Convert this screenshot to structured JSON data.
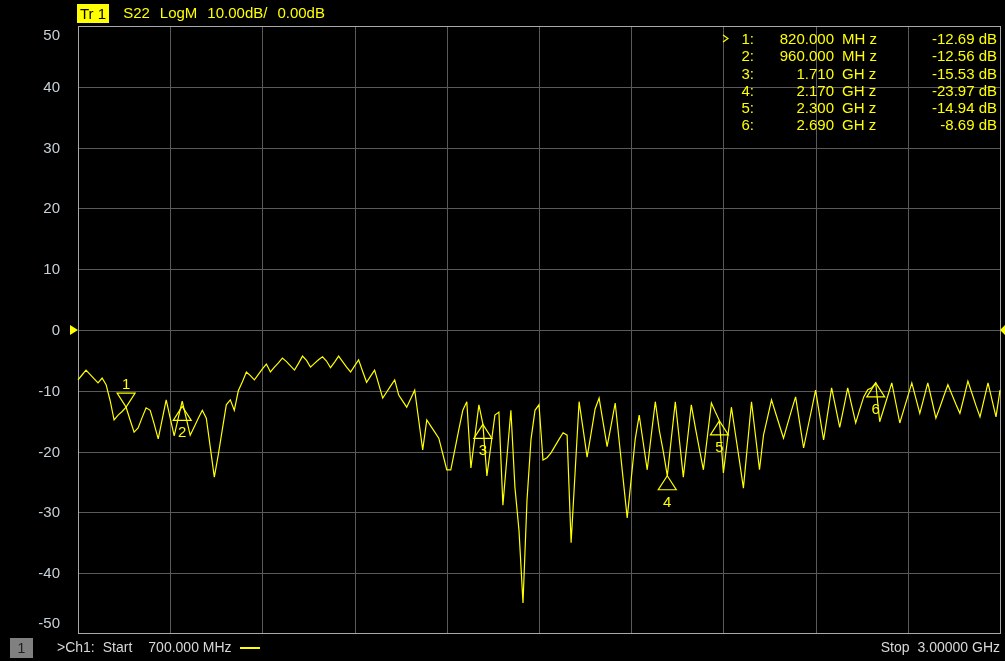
{
  "trace": {
    "name": "Tr 1",
    "active": true,
    "format": "LogM",
    "scale": "10.00dB/",
    "ref": "0.00dB"
  },
  "markers": [
    {
      "label": "1",
      "number": "1:",
      "freq": "820.000",
      "unit": "MH z",
      "value": "-12.69 dB",
      "selected": true
    },
    {
      "label": "2",
      "number": "2:",
      "freq": "960.000",
      "unit": "MH z",
      "value": "-12.56 dB",
      "selected": false
    },
    {
      "label": "3",
      "number": "3:",
      "freq": "1.710",
      "unit": "GH z",
      "value": "-15.53 dB",
      "selected": false
    },
    {
      "label": "4",
      "number": "4:",
      "freq": "2.170",
      "unit": "GH z",
      "value": "-23.97 dB",
      "selected": false
    },
    {
      "label": "5",
      "number": "5:",
      "freq": "2.300",
      "unit": "GH z",
      "value": "-14.94 dB",
      "selected": false
    },
    {
      "label": "6",
      "number": "6:",
      "freq": "2.690",
      "unit": "GH z",
      "value": "-8.69 dB",
      "selected": false
    }
  ],
  "chart_data": {
    "type": "line",
    "grid": true,
    "ylim": [
      -50,
      50
    ],
    "yticks": [
      50,
      40,
      30,
      20,
      10,
      0,
      -10,
      -20,
      -30,
      -40,
      -50
    ],
    "categories": [
      null,
      null,
      null,
      null,
      null,
      null,
      null,
      null,
      null,
      null,
      null,
      null,
      null,
      null,
      null,
      null,
      null,
      null,
      null,
      null,
      null,
      null,
      null,
      null,
      null,
      null,
      null,
      null,
      null,
      null,
      null,
      null,
      null,
      null,
      null,
      null,
      null,
      null,
      null,
      null,
      null,
      null,
      null,
      null,
      null,
      null,
      null,
      null,
      null,
      null,
      null,
      null,
      null,
      null,
      null,
      null,
      null,
      null,
      null,
      null,
      null,
      null,
      null,
      null,
      null,
      null,
      null,
      null,
      null,
      null,
      null,
      null,
      null,
      null,
      null,
      null,
      null,
      null,
      null,
      null,
      null,
      null,
      null,
      null,
      null,
      null,
      null,
      null,
      null,
      null,
      null,
      null,
      null,
      null,
      null,
      null,
      null,
      null,
      null,
      null,
      null,
      null,
      null,
      null,
      null,
      null,
      null,
      null,
      null,
      null,
      null,
      null,
      null,
      null,
      null,
      null,
      null,
      null,
      null,
      null,
      null,
      null,
      null,
      null,
      null,
      null,
      null,
      null,
      null,
      null,
      null,
      null,
      null,
      null,
      null,
      null,
      null,
      null,
      null,
      null,
      null,
      null,
      null,
      null,
      null,
      null,
      null,
      null,
      null,
      null,
      null,
      null,
      null,
      null,
      null,
      null,
      null,
      null,
      null,
      null,
      null,
      null,
      null,
      null,
      null,
      null,
      null,
      null,
      null,
      null,
      null,
      null,
      null,
      null,
      null,
      null,
      null,
      null,
      null,
      null,
      null,
      null,
      null,
      null,
      null,
      null,
      null,
      null,
      null,
      null,
      null,
      null,
      null,
      null,
      null,
      null,
      null,
      null,
      null,
      null,
      null,
      null,
      null,
      null,
      null,
      null,
      null,
      null,
      null,
      null,
      null,
      null,
      null,
      null,
      null,
      null,
      null,
      null,
      null,
      null,
      null,
      null,
      null,
      null,
      null,
      null,
      null,
      null,
      null,
      null,
      null
    ],
    "series": [
      {
        "name": "S22",
        "color": "#ffff00",
        "values": [
          -8.2,
          -7.4,
          -6.6,
          -7.3,
          -8.0,
          -8.7,
          -7.9,
          -9.0,
          -11.6,
          -14.8,
          -14.0,
          -13.4,
          -12.7,
          -14.8,
          -16.8,
          -16.1,
          -14.4,
          -12.8,
          -13.2,
          -15.5,
          -17.9,
          -14.7,
          -11.5,
          -14.5,
          -17.4,
          -14.5,
          -11.7,
          -14.5,
          -17.3,
          -15.9,
          -14.5,
          -13.2,
          -14.5,
          -19.3,
          -24.2,
          -20.5,
          -16.4,
          -12.3,
          -11.5,
          -13.2,
          -10.0,
          -8.5,
          -6.9,
          -7.5,
          -8.2,
          -7.3,
          -6.4,
          -5.6,
          -6.9,
          -6.1,
          -5.4,
          -4.6,
          -5.2,
          -5.9,
          -6.6,
          -5.5,
          -4.3,
          -5.0,
          -6.1,
          -5.5,
          -4.9,
          -4.4,
          -5.1,
          -6.2,
          -5.3,
          -4.3,
          -5.2,
          -6.1,
          -6.9,
          -5.9,
          -4.9,
          -6.8,
          -8.6,
          -7.6,
          -6.6,
          -8.9,
          -11.2,
          -10.2,
          -9.2,
          -8.2,
          -10.7,
          -11.7,
          -12.7,
          -11.3,
          -9.9,
          -14.8,
          -19.7,
          -14.8,
          -15.8,
          -16.8,
          -17.8,
          -20.4,
          -23.0,
          -23.0,
          -19.7,
          -16.4,
          -13.2,
          -11.8,
          -22.7,
          -17.5,
          -12.3,
          -15.5,
          -24.0,
          -19.0,
          -14.0,
          -13.5,
          -28.8,
          -21.0,
          -13.2,
          -25.8,
          -33.0,
          -44.9,
          -28.0,
          -18.0,
          -13.2,
          -12.3,
          -21.4,
          -21.0,
          -20.2,
          -19.1,
          -18.0,
          -16.9,
          -17.3,
          -35.0,
          -23.4,
          -11.8,
          -16.3,
          -20.9,
          -17.0,
          -13.0,
          -11.2,
          -15.2,
          -19.2,
          -15.6,
          -12.0,
          -18.3,
          -24.6,
          -30.9,
          -24.5,
          -18.0,
          -14.0,
          -18.5,
          -23.0,
          -17.4,
          -11.8,
          -16.5,
          -20.0,
          -24.0,
          -17.9,
          -11.8,
          -18.0,
          -24.2,
          -18.3,
          -12.3,
          -16.0,
          -19.5,
          -23.0,
          -17.5,
          -12.0,
          -13.5,
          -14.9,
          -23.5,
          -18.1,
          -12.7,
          -17.1,
          -21.5,
          -26.0,
          -18.9,
          -11.8,
          -17.4,
          -23.0,
          -17.3,
          -14.4,
          -11.5,
          -13.6,
          -15.7,
          -17.8,
          -15.5,
          -13.2,
          -11.0,
          -15.2,
          -19.4,
          -16.2,
          -13.1,
          -9.9,
          -14.0,
          -18.1,
          -13.8,
          -9.5,
          -12.7,
          -16.0,
          -12.8,
          -9.5,
          -12.4,
          -15.3,
          -13.1,
          -11.0,
          -9.8,
          -9.5,
          -8.7,
          -15.1,
          -13.0,
          -10.8,
          -8.7,
          -12.0,
          -15.3,
          -13.1,
          -10.9,
          -8.7,
          -11.2,
          -13.7,
          -11.2,
          -8.7,
          -11.6,
          -14.5,
          -12.7,
          -10.8,
          -9.0,
          -10.6,
          -12.2,
          -13.7,
          -11.1,
          -8.4,
          -10.4,
          -12.4,
          -14.3,
          -11.5,
          -8.7,
          -11.5,
          -14.3,
          -9.9
        ]
      }
    ]
  },
  "channel": {
    "number": "1",
    "label": ">Ch1:",
    "start_label": "Start",
    "start": "700.000 MHz",
    "stop_label": "Stop",
    "stop": "3.00000 GHz"
  }
}
